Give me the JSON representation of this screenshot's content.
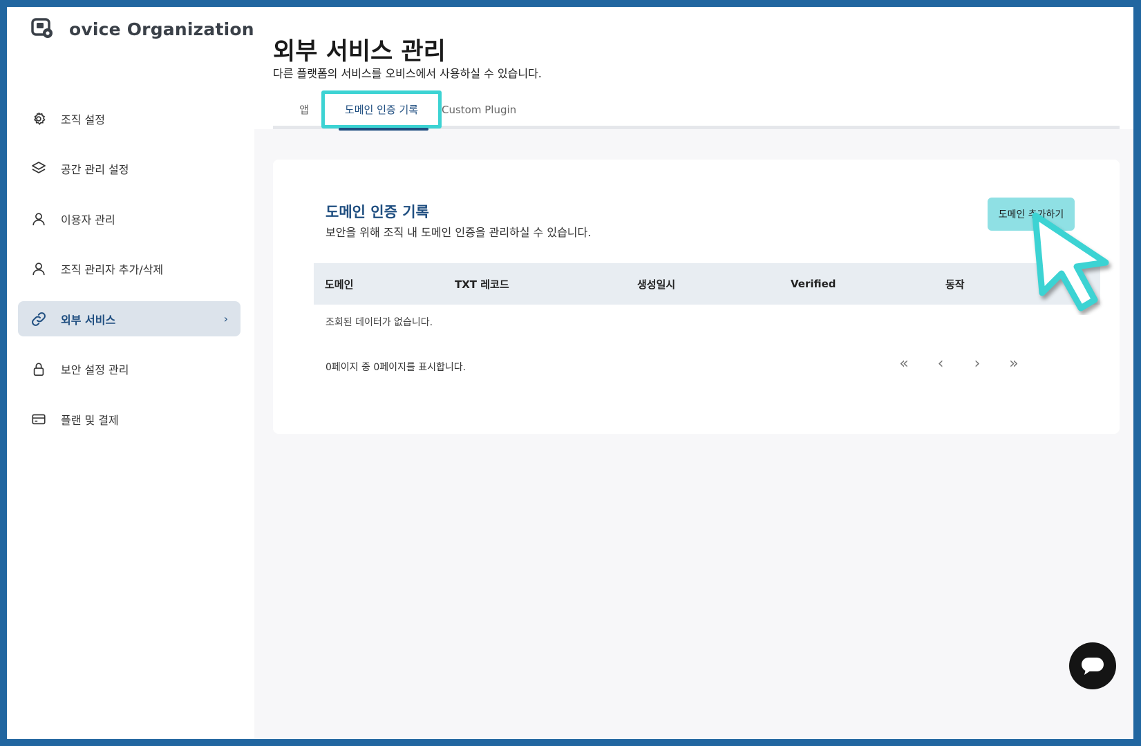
{
  "org": {
    "name": "ovice Organization",
    "logo_icon": "org-logo-icon"
  },
  "sidebar": {
    "items": [
      {
        "label": "조직 설정",
        "icon": "gear-icon"
      },
      {
        "label": "공간 관리 설정",
        "icon": "layers-icon"
      },
      {
        "label": "이용자 관리",
        "icon": "user-icon"
      },
      {
        "label": "조직 관리자 추가/삭제",
        "icon": "user-icon"
      },
      {
        "label": "외부 서비스",
        "icon": "link-icon",
        "active": true,
        "chevron": "›"
      },
      {
        "label": "보안 설정 관리",
        "icon": "lock-icon"
      },
      {
        "label": "플랜 및 결제",
        "icon": "credit-card-icon"
      }
    ]
  },
  "page": {
    "title": "외부 서비스 관리",
    "subtitle": "다른 플랫폼의 서비스를 오비스에서 사용하실 수 있습니다."
  },
  "tabs": [
    {
      "label": "앱"
    },
    {
      "label": "도메인 인증 기록",
      "active": true
    },
    {
      "label": "Custom Plugin"
    }
  ],
  "card": {
    "title": "도메인 인증 기록",
    "subtitle": "보안을 위해 조직 내 도메인 인증을 관리하실 수 있습니다.",
    "add_button": "도메인 추가하기",
    "columns": [
      "도메인",
      "TXT 레코드",
      "생성일시",
      "Verified",
      "동작"
    ],
    "empty_text": "조회된 데이터가 없습니다.",
    "pager_text": "0페이지 중 0페이지를 표시합니다.",
    "pager": {
      "first": "«",
      "prev": "‹",
      "next": "›",
      "last": "»"
    }
  },
  "colors": {
    "accent": "#1f4e80",
    "highlight": "#3cd3d3",
    "button": "#8fe0e4",
    "frame": "#2166a0"
  }
}
